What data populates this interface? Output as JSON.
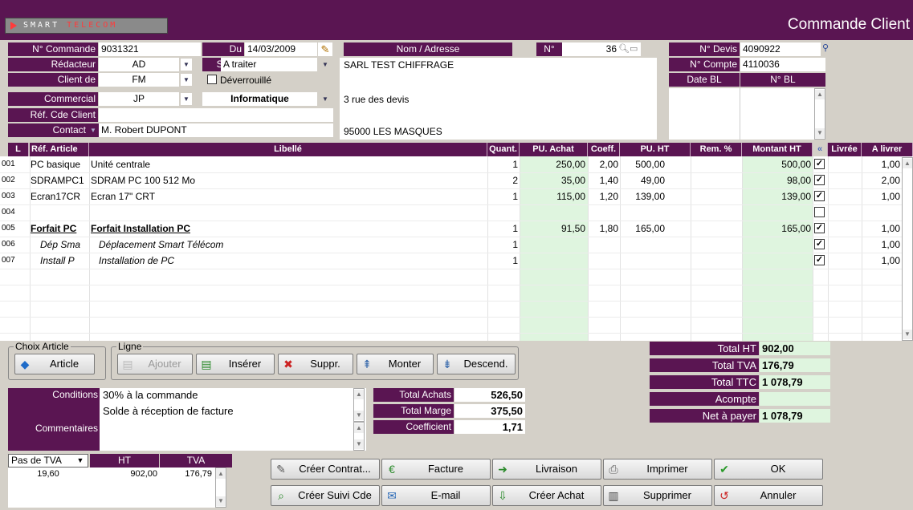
{
  "app": {
    "logo_smart": "SMART",
    "logo_telecom": "TELECOM",
    "title": "Commande Client"
  },
  "header": {
    "num_commande_label": "N° Commande",
    "num_commande": "9031321",
    "du_label": "Du",
    "du": "14/03/2009",
    "redacteur_label": "Rédacteur",
    "redacteur": "AD",
    "statut_label": "Statut",
    "statut": "A traiter",
    "client_de_label": "Client de",
    "client_de": "FM",
    "deverrouille": "Déverrouillé",
    "commercial_label": "Commercial",
    "commercial": "JP",
    "categorie": "Informatique",
    "ref_cde_label": "Réf. Cde Client",
    "ref_cde": "",
    "contact_label": "Contact",
    "contact": "M. Robert DUPONT",
    "nom_label": "Nom / Adresse",
    "num_label": "N°",
    "num": "36",
    "nom": "SARL TEST CHIFFRAGE",
    "adresse": "3 rue des devis",
    "ville": "95000 LES MASQUES",
    "devis_label": "N° Devis",
    "devis": "4090922",
    "compte_label": "N° Compte",
    "compte": "4110036",
    "date_bl_label": "Date BL",
    "num_bl_label": "N° BL"
  },
  "grid": {
    "headers": [
      "L",
      "Réf. Article",
      "Libellé",
      "Quant.",
      "PU. Achat",
      "Coeff.",
      "PU. HT",
      "Rem. %",
      "Montant HT",
      "«",
      "Livrée",
      "A livrer"
    ],
    "rows": [
      {
        "l": "001",
        "ref": "PC basique",
        "lib": "Unité centrale",
        "q": "1",
        "pua": "250,00",
        "coef": "2,00",
        "puht": "500,00",
        "rem": "",
        "mont": "500,00",
        "chk": true,
        "liv": "",
        "al": "1,00",
        "style": "n"
      },
      {
        "l": "002",
        "ref": "SDRAMPC1",
        "lib": "SDRAM PC 100 512 Mo",
        "q": "2",
        "pua": "35,00",
        "coef": "1,40",
        "puht": "49,00",
        "rem": "",
        "mont": "98,00",
        "chk": true,
        "liv": "",
        "al": "2,00",
        "style": "n"
      },
      {
        "l": "003",
        "ref": "Ecran17CR",
        "lib": "Ecran 17\" CRT",
        "q": "1",
        "pua": "115,00",
        "coef": "1,20",
        "puht": "139,00",
        "rem": "",
        "mont": "139,00",
        "chk": true,
        "liv": "",
        "al": "1,00",
        "style": "n"
      },
      {
        "l": "004",
        "ref": "",
        "lib": "",
        "q": "",
        "pua": "",
        "coef": "",
        "puht": "",
        "rem": "",
        "mont": "",
        "chk": false,
        "liv": "",
        "al": "",
        "style": "n"
      },
      {
        "l": "005",
        "ref": "Forfait PC",
        "lib": "Forfait Installation PC",
        "q": "1",
        "pua": "91,50",
        "coef": "1,80",
        "puht": "165,00",
        "rem": "",
        "mont": "165,00",
        "chk": true,
        "liv": "",
        "al": "1,00",
        "style": "b"
      },
      {
        "l": "006",
        "ref": "Dép Sma",
        "lib": "Déplacement Smart Télécom",
        "q": "1",
        "pua": "",
        "coef": "",
        "puht": "",
        "rem": "",
        "mont": "",
        "chk": true,
        "liv": "",
        "al": "1,00",
        "style": "i"
      },
      {
        "l": "007",
        "ref": "Install P",
        "lib": "Installation de PC",
        "q": "1",
        "pua": "",
        "coef": "",
        "puht": "",
        "rem": "",
        "mont": "",
        "chk": true,
        "liv": "",
        "al": "1,00",
        "style": "i"
      }
    ]
  },
  "choix": {
    "legend": "Choix Article",
    "article": "Article"
  },
  "ligne": {
    "legend": "Ligne",
    "ajouter": "Ajouter",
    "inserer": "Insérer",
    "suppr": "Suppr.",
    "monter": "Monter",
    "descend": "Descend."
  },
  "totaux": {
    "ht_label": "Total HT",
    "ht": "902,00",
    "tva_label": "Total TVA",
    "tva": "176,79",
    "ttc_label": "Total TTC",
    "ttc": "1 078,79",
    "acompte_label": "Acompte",
    "acompte": "",
    "net_label": "Net à payer",
    "net": "1 078,79"
  },
  "conditions": {
    "label": "Conditions",
    "line1": "30% à la commande",
    "line2": "Solde à réception de facture",
    "comm_label": "Commentaires"
  },
  "marges": {
    "achats_label": "Total Achats",
    "achats": "526,50",
    "marge_label": "Total Marge",
    "marge": "375,50",
    "coef_label": "Coefficient",
    "coef": "1,71"
  },
  "tva": {
    "select": "Pas de TVA",
    "ht_label": "HT",
    "tva_label": "TVA",
    "rate": "19,60",
    "ht": "902,00",
    "tva": "176,79"
  },
  "actions": {
    "contrat": "Créer Contrat...",
    "facture": "Facture",
    "livraison": "Livraison",
    "imprimer": "Imprimer",
    "ok": "OK",
    "suivi": "Créer Suivi Cde",
    "email": "E-mail",
    "achat": "Créer Achat",
    "supprimer": "Supprimer",
    "annuler": "Annuler"
  },
  "colors": {
    "purple": "#5a1552",
    "green": "#dff5df",
    "bg": "#d4d0c8"
  }
}
